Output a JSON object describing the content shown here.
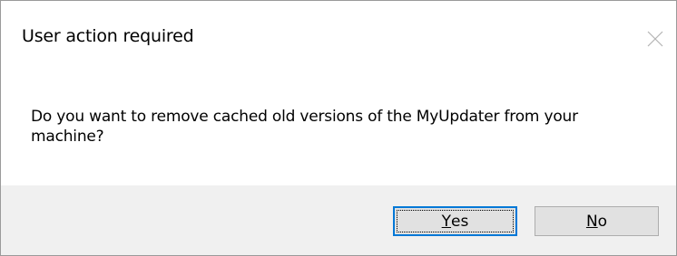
{
  "dialog": {
    "title": "User action required",
    "message": "Do you want to remove cached old versions of the MyUpdater from your machine?",
    "close_icon": "close-icon"
  },
  "buttons": {
    "yes": {
      "key": "Y",
      "rest": "es",
      "is_default": true
    },
    "no": {
      "key": "N",
      "rest": "o",
      "is_default": false
    }
  },
  "colors": {
    "footer_background": "#f0f0f0",
    "button_face": "#e1e1e1",
    "default_button_border": "#0078d7"
  }
}
